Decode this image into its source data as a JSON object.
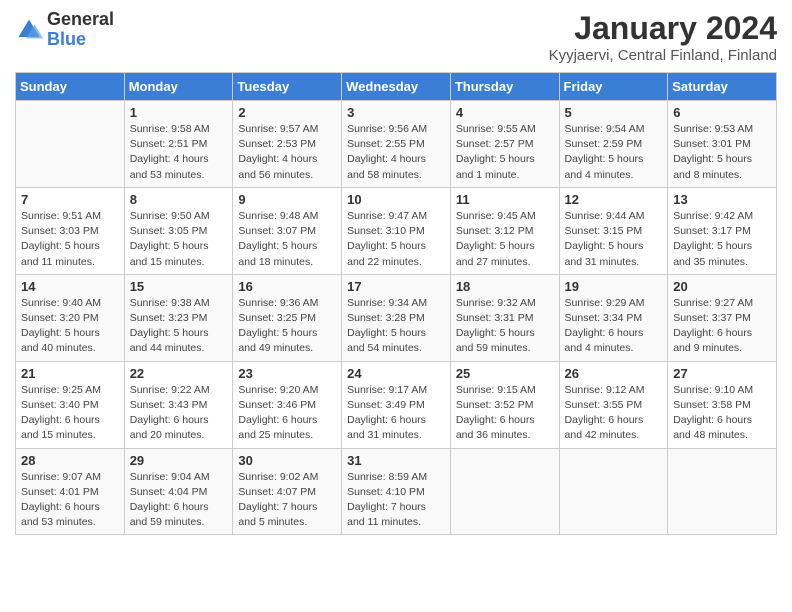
{
  "header": {
    "logo_general": "General",
    "logo_blue": "Blue",
    "month_year": "January 2024",
    "location": "Kyyjaervi, Central Finland, Finland"
  },
  "weekdays": [
    "Sunday",
    "Monday",
    "Tuesday",
    "Wednesday",
    "Thursday",
    "Friday",
    "Saturday"
  ],
  "weeks": [
    [
      {
        "day": "",
        "info": ""
      },
      {
        "day": "1",
        "info": "Sunrise: 9:58 AM\nSunset: 2:51 PM\nDaylight: 4 hours\nand 53 minutes."
      },
      {
        "day": "2",
        "info": "Sunrise: 9:57 AM\nSunset: 2:53 PM\nDaylight: 4 hours\nand 56 minutes."
      },
      {
        "day": "3",
        "info": "Sunrise: 9:56 AM\nSunset: 2:55 PM\nDaylight: 4 hours\nand 58 minutes."
      },
      {
        "day": "4",
        "info": "Sunrise: 9:55 AM\nSunset: 2:57 PM\nDaylight: 5 hours\nand 1 minute."
      },
      {
        "day": "5",
        "info": "Sunrise: 9:54 AM\nSunset: 2:59 PM\nDaylight: 5 hours\nand 4 minutes."
      },
      {
        "day": "6",
        "info": "Sunrise: 9:53 AM\nSunset: 3:01 PM\nDaylight: 5 hours\nand 8 minutes."
      }
    ],
    [
      {
        "day": "7",
        "info": "Sunrise: 9:51 AM\nSunset: 3:03 PM\nDaylight: 5 hours\nand 11 minutes."
      },
      {
        "day": "8",
        "info": "Sunrise: 9:50 AM\nSunset: 3:05 PM\nDaylight: 5 hours\nand 15 minutes."
      },
      {
        "day": "9",
        "info": "Sunrise: 9:48 AM\nSunset: 3:07 PM\nDaylight: 5 hours\nand 18 minutes."
      },
      {
        "day": "10",
        "info": "Sunrise: 9:47 AM\nSunset: 3:10 PM\nDaylight: 5 hours\nand 22 minutes."
      },
      {
        "day": "11",
        "info": "Sunrise: 9:45 AM\nSunset: 3:12 PM\nDaylight: 5 hours\nand 27 minutes."
      },
      {
        "day": "12",
        "info": "Sunrise: 9:44 AM\nSunset: 3:15 PM\nDaylight: 5 hours\nand 31 minutes."
      },
      {
        "day": "13",
        "info": "Sunrise: 9:42 AM\nSunset: 3:17 PM\nDaylight: 5 hours\nand 35 minutes."
      }
    ],
    [
      {
        "day": "14",
        "info": "Sunrise: 9:40 AM\nSunset: 3:20 PM\nDaylight: 5 hours\nand 40 minutes."
      },
      {
        "day": "15",
        "info": "Sunrise: 9:38 AM\nSunset: 3:23 PM\nDaylight: 5 hours\nand 44 minutes."
      },
      {
        "day": "16",
        "info": "Sunrise: 9:36 AM\nSunset: 3:25 PM\nDaylight: 5 hours\nand 49 minutes."
      },
      {
        "day": "17",
        "info": "Sunrise: 9:34 AM\nSunset: 3:28 PM\nDaylight: 5 hours\nand 54 minutes."
      },
      {
        "day": "18",
        "info": "Sunrise: 9:32 AM\nSunset: 3:31 PM\nDaylight: 5 hours\nand 59 minutes."
      },
      {
        "day": "19",
        "info": "Sunrise: 9:29 AM\nSunset: 3:34 PM\nDaylight: 6 hours\nand 4 minutes."
      },
      {
        "day": "20",
        "info": "Sunrise: 9:27 AM\nSunset: 3:37 PM\nDaylight: 6 hours\nand 9 minutes."
      }
    ],
    [
      {
        "day": "21",
        "info": "Sunrise: 9:25 AM\nSunset: 3:40 PM\nDaylight: 6 hours\nand 15 minutes."
      },
      {
        "day": "22",
        "info": "Sunrise: 9:22 AM\nSunset: 3:43 PM\nDaylight: 6 hours\nand 20 minutes."
      },
      {
        "day": "23",
        "info": "Sunrise: 9:20 AM\nSunset: 3:46 PM\nDaylight: 6 hours\nand 25 minutes."
      },
      {
        "day": "24",
        "info": "Sunrise: 9:17 AM\nSunset: 3:49 PM\nDaylight: 6 hours\nand 31 minutes."
      },
      {
        "day": "25",
        "info": "Sunrise: 9:15 AM\nSunset: 3:52 PM\nDaylight: 6 hours\nand 36 minutes."
      },
      {
        "day": "26",
        "info": "Sunrise: 9:12 AM\nSunset: 3:55 PM\nDaylight: 6 hours\nand 42 minutes."
      },
      {
        "day": "27",
        "info": "Sunrise: 9:10 AM\nSunset: 3:58 PM\nDaylight: 6 hours\nand 48 minutes."
      }
    ],
    [
      {
        "day": "28",
        "info": "Sunrise: 9:07 AM\nSunset: 4:01 PM\nDaylight: 6 hours\nand 53 minutes."
      },
      {
        "day": "29",
        "info": "Sunrise: 9:04 AM\nSunset: 4:04 PM\nDaylight: 6 hours\nand 59 minutes."
      },
      {
        "day": "30",
        "info": "Sunrise: 9:02 AM\nSunset: 4:07 PM\nDaylight: 7 hours\nand 5 minutes."
      },
      {
        "day": "31",
        "info": "Sunrise: 8:59 AM\nSunset: 4:10 PM\nDaylight: 7 hours\nand 11 minutes."
      },
      {
        "day": "",
        "info": ""
      },
      {
        "day": "",
        "info": ""
      },
      {
        "day": "",
        "info": ""
      }
    ]
  ]
}
